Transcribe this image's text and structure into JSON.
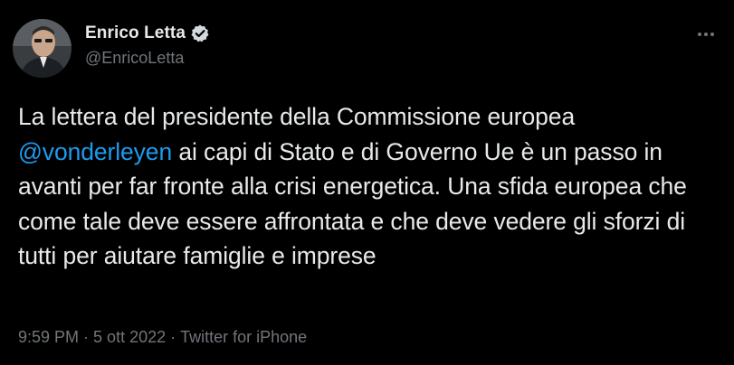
{
  "author": {
    "display_name": "Enrico Letta",
    "handle": "@EnricoLetta",
    "verified": true,
    "avatar_icon": "profile-photo-avatar"
  },
  "tweet": {
    "text_part_1": "La lettera del presidente della Commissione europea ",
    "mention": "@vonderleyen",
    "text_part_2": " ai capi di Stato e di Governo Ue è un passo in avanti per far fronte alla crisi energetica. Una sfida europea che come tale deve essere affrontata e che deve vedere gli sforzi di tutti per aiutare famiglie e imprese"
  },
  "meta": {
    "time": "9:59 PM",
    "separator": "·",
    "date": "5 ott 2022",
    "source": "Twitter for iPhone"
  },
  "colors": {
    "background": "#000000",
    "text": "#e7e9ea",
    "secondary": "#71767b",
    "link": "#1d9bf0"
  },
  "icons": {
    "verified": "verified-badge-icon",
    "more": "more-options-icon"
  }
}
